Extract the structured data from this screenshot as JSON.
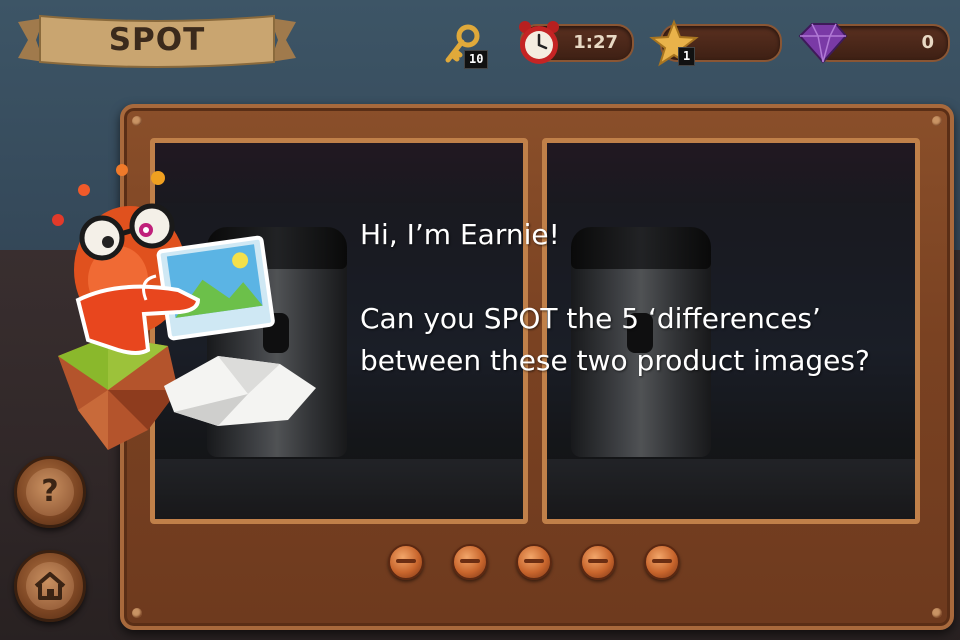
{
  "header": {
    "title": "SPOT",
    "keys_count": "10",
    "timer": "1:27",
    "stars_count": "1",
    "gems_count": "0"
  },
  "dialog": {
    "greeting": "Hi, I’m Earnie!",
    "message": "Can you SPOT the 5 ‘differences’ between these two product images?"
  },
  "differences_total": 5,
  "colors": {
    "wood": "#7a4222",
    "frame": "#c08049",
    "accent_orange": "#e0511e",
    "gem": "#7a3aa6"
  },
  "icons": {
    "keys": "key-icon",
    "timer": "alarm-clock-icon",
    "stars": "star-icon",
    "gems": "gem-icon",
    "help": "question-icon",
    "home": "home-icon"
  }
}
